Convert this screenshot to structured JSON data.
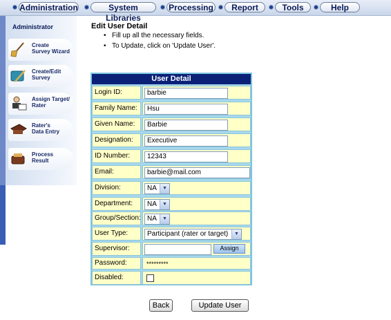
{
  "nav": {
    "tabs": [
      "Administration",
      "System Libraries",
      "Processing",
      "Report",
      "Tools",
      "Help"
    ]
  },
  "sidebar": {
    "title": "Administrator",
    "items": [
      {
        "line1": "Create",
        "line2": "Survey Wizard",
        "icon": "broom-wizard-icon"
      },
      {
        "line1": "Create/Edit",
        "line2": "Survey",
        "icon": "survey-edit-icon"
      },
      {
        "line1": "Assign Target/",
        "line2": "Rater",
        "icon": "assign-target-icon"
      },
      {
        "line1": "Rater's",
        "line2": "Data Entry",
        "icon": "data-entry-icon"
      },
      {
        "line1": "Process",
        "line2": "Result",
        "icon": "process-result-icon"
      }
    ]
  },
  "main": {
    "title": "Edit User Detail",
    "instructions": [
      "Fill up all the necessary fields.",
      "To Update, click on 'Update User'."
    ],
    "table_header": "User Detail"
  },
  "form": {
    "login_id": {
      "label": "Login ID:",
      "value": "barbie"
    },
    "family_name": {
      "label": "Family Name:",
      "value": "Hsu"
    },
    "given_name": {
      "label": "Given Name:",
      "value": "Barbie"
    },
    "designation": {
      "label": "Designation:",
      "value": "Executive"
    },
    "id_number": {
      "label": "ID Number:",
      "value": "12343"
    },
    "email": {
      "label": "Email:",
      "value": "barbie@mail.com"
    },
    "division": {
      "label": "Division:",
      "value": "NA"
    },
    "department": {
      "label": "Department:",
      "value": "NA"
    },
    "group_section": {
      "label": "Group/Section:",
      "value": "NA"
    },
    "user_type": {
      "label": "User Type:",
      "value": "Participant (rater or target)"
    },
    "supervisor": {
      "label": "Supervisor:",
      "value": "",
      "button": "Assign"
    },
    "password": {
      "label": "Password:",
      "value": "*********"
    },
    "disabled": {
      "label": "Disabled:",
      "checked": false
    }
  },
  "buttons": {
    "back": "Back",
    "update": "Update User"
  },
  "colors": {
    "header_bg": "#0b2177",
    "cell_bg": "#ffffc8",
    "table_border": "#7ec6e0"
  }
}
